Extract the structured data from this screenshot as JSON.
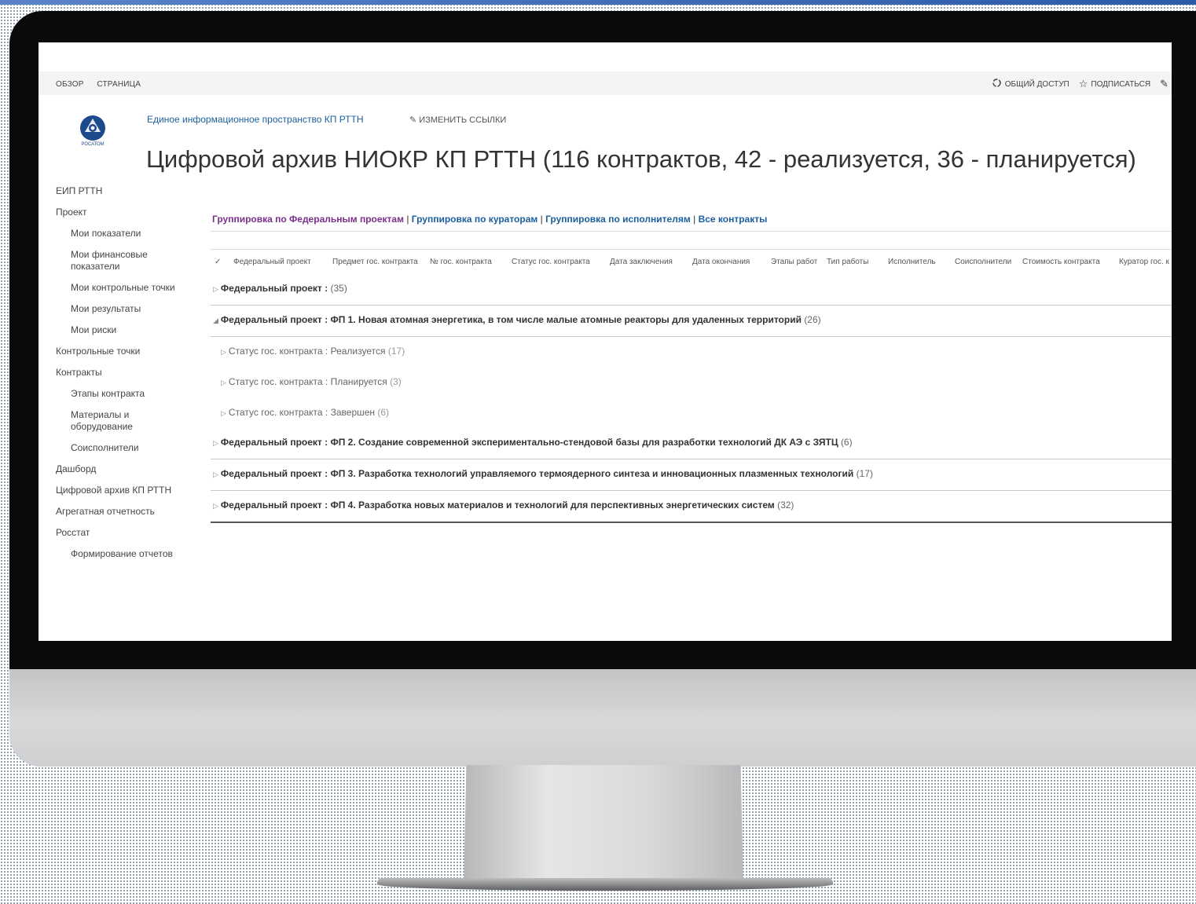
{
  "ribbon": {
    "tab_browse": "ОБЗОР",
    "tab_page": "СТРАНИЦА",
    "share": "ОБЩИЙ ДОСТУП",
    "follow": "ПОДПИСАТЬСЯ"
  },
  "header": {
    "logo_text": "РОСАТОМ",
    "breadcrumb": "Единое информационное пространство КП РТТН",
    "edit_links": "ИЗМЕНИТЬ ССЫЛКИ",
    "title": "Цифровой архив НИОКР КП РТТН  (116 контрактов, 42 - реализуется, 36 - планируется)"
  },
  "nav": [
    {
      "label": "ЕИП РТТН",
      "level": 0
    },
    {
      "label": "Проект",
      "level": 0
    },
    {
      "label": "Мои показатели",
      "level": 1
    },
    {
      "label": "Мои финансовые показатели",
      "level": 1
    },
    {
      "label": "Мои контрольные точки",
      "level": 1
    },
    {
      "label": "Мои результаты",
      "level": 1
    },
    {
      "label": "Мои риски",
      "level": 1
    },
    {
      "label": "Контрольные точки",
      "level": 0
    },
    {
      "label": "Контракты",
      "level": 0
    },
    {
      "label": "Этапы контракта",
      "level": 1
    },
    {
      "label": "Материалы и оборудование",
      "level": 1
    },
    {
      "label": "Соисполнители",
      "level": 1
    },
    {
      "label": "Дашборд",
      "level": 0
    },
    {
      "label": "Цифровой архив КП РТТН",
      "level": 0
    },
    {
      "label": "Агрегатная отчетность",
      "level": 0
    },
    {
      "label": "Росстат",
      "level": 0
    },
    {
      "label": "Формирование отчетов",
      "level": 1
    }
  ],
  "grouping": {
    "by_federal": "Группировка по Федеральным проектам",
    "by_curators": "Группировка по кураторам",
    "by_executors": "Группировка по исполнителям",
    "all": "Все контракты",
    "separator": "|"
  },
  "columns": [
    "✓",
    "Федеральный проект",
    "Предмет гос. контракта",
    "№ гос. контракта",
    "Статус гос. контракта",
    "Дата заключения",
    "Дата окончания",
    "Этапы работ",
    "Тип работы",
    "Исполнитель",
    "Соисполнители",
    "Стоимость контракта",
    "Куратор гос. к"
  ],
  "groups": {
    "g0": {
      "label": "Федеральный проект :",
      "value": "",
      "count": "(35)"
    },
    "g1": {
      "label": "Федеральный проект :",
      "value": "ФП 1. Новая атомная энергетика, в том числе малые атомные реакторы для удаленных территорий",
      "count": "(26)"
    },
    "s1": {
      "label": "Статус гос. контракта :",
      "value": "Реализуется",
      "count": "(17)"
    },
    "s2": {
      "label": "Статус гос. контракта :",
      "value": "Планируется",
      "count": "(3)"
    },
    "s3": {
      "label": "Статус гос. контракта :",
      "value": "Завершен",
      "count": "(6)"
    },
    "g2": {
      "label": "Федеральный проект :",
      "value": "ФП 2. Создание современной экспериментально-стендовой базы для разработки технологий ДК АЭ с ЗЯТЦ",
      "count": "(6)"
    },
    "g3": {
      "label": "Федеральный проект :",
      "value": "ФП 3. Разработка технологий управляемого термоядерного синтеза и инновационных плазменных технологий",
      "count": "(17)"
    },
    "g4": {
      "label": "Федеральный проект :",
      "value": "ФП 4. Разработка новых материалов и технологий для перспективных энергетических систем",
      "count": "(32)"
    }
  },
  "icons": {
    "expand": "triangle-right",
    "collapse": "triangle-down",
    "share": "share-icon",
    "follow": "star-icon",
    "edit": "pencil-icon"
  },
  "colors": {
    "link": "#1a5f9e",
    "visited": "#7a2f8a",
    "text": "#333333"
  }
}
